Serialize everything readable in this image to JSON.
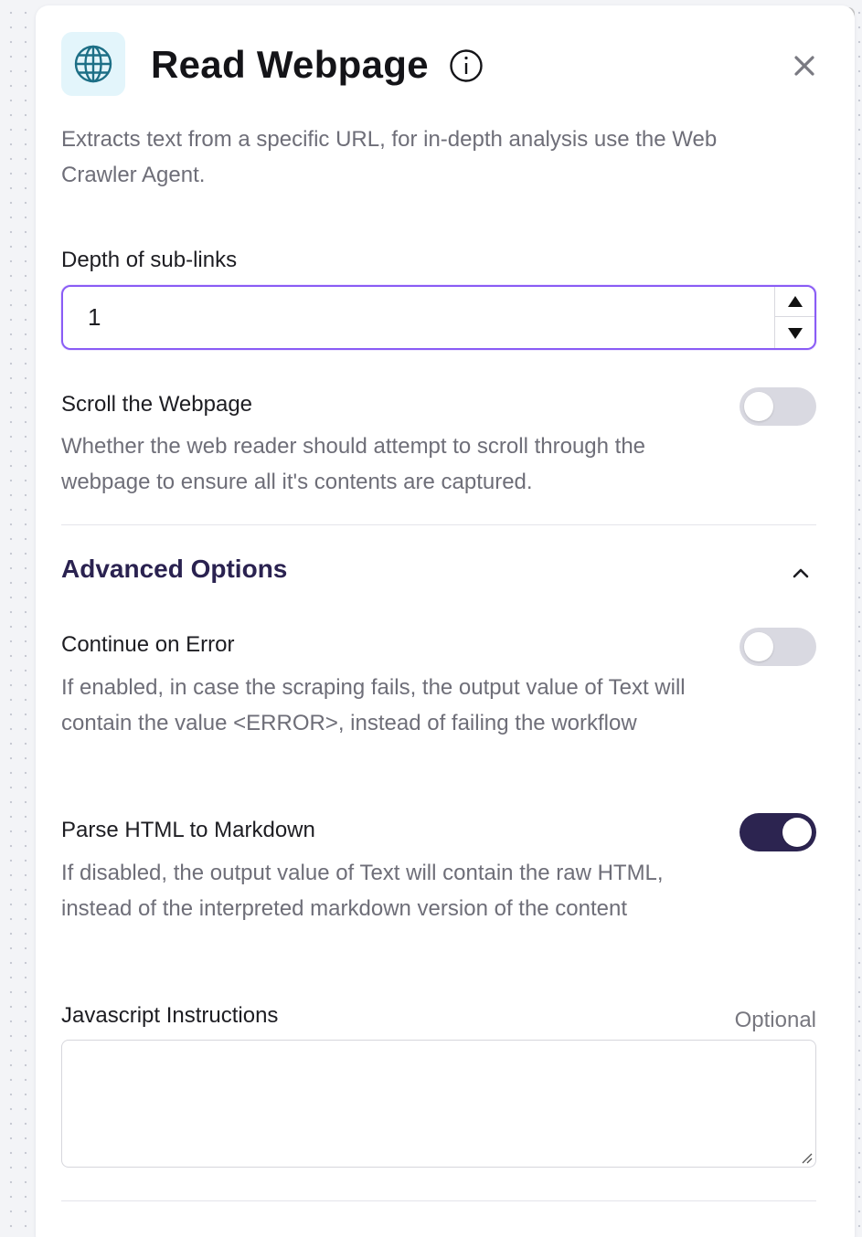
{
  "header": {
    "title": "Read Webpage",
    "app_icon": "globe-icon",
    "info_icon": "info-icon",
    "close_icon": "close-icon"
  },
  "description": "Extracts text from a specific URL, for in-depth analysis use the Web Crawler Agent.",
  "depth": {
    "label": "Depth of sub-links",
    "value": "1"
  },
  "scroll": {
    "label": "Scroll the Webpage",
    "help": "Whether the web reader should attempt to scroll through the webpage to ensure all it's contents are captured.",
    "enabled": false
  },
  "advanced": {
    "title": "Advanced Options",
    "expanded": true,
    "continue_on_error": {
      "label": "Continue on Error",
      "help": "If enabled, in case the scraping fails, the output value of Text will contain the value <ERROR>, instead of failing the workflow",
      "enabled": false
    },
    "parse_html": {
      "label": "Parse HTML to Markdown",
      "help": "If disabled, the output value of Text will contain the raw HTML, instead of the interpreted markdown version of the content",
      "enabled": true
    },
    "js_instructions": {
      "label": "Javascript Instructions",
      "optional_label": "Optional",
      "value": ""
    }
  },
  "colors": {
    "accent": "#8a5cf5",
    "toggle_on": "#2c2450",
    "toggle_off": "#d9d9e1",
    "icon_bg": "#e3f5fb",
    "icon_stroke": "#1d6f86"
  }
}
